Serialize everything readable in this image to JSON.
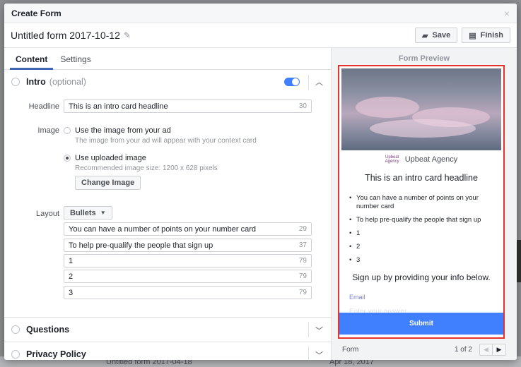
{
  "modal": {
    "title": "Create Form",
    "close": "×"
  },
  "form": {
    "name": "Untitled form 2017-10-12",
    "save_label": "Save",
    "finish_label": "Finish"
  },
  "tabs": [
    {
      "label": "Content",
      "active": true
    },
    {
      "label": "Settings",
      "active": false
    }
  ],
  "intro": {
    "title": "Intro",
    "optional": "(optional)",
    "enabled": true,
    "headline_label": "Headline",
    "headline_value": "This is an intro card headline",
    "headline_count": "30",
    "image_label": "Image",
    "image_option1_title": "Use the image from your ad",
    "image_option1_sub": "The image from your ad will appear with your context card",
    "image_option2_title": "Use uploaded image",
    "image_option2_sub": "Recommended image size: 1200 x 628 pixels",
    "change_image": "Change Image",
    "layout_label": "Layout",
    "layout_value": "Bullets",
    "bullets": [
      {
        "text": "You can have a number of points on your number card",
        "count": "29"
      },
      {
        "text": "To help pre-qualify the people that sign up",
        "count": "37"
      },
      {
        "text": "1",
        "count": "79"
      },
      {
        "text": "2",
        "count": "79"
      },
      {
        "text": "3",
        "count": "79"
      }
    ]
  },
  "sections": {
    "questions": "Questions",
    "privacy": "Privacy Policy"
  },
  "preview": {
    "title": "Form Preview",
    "brand_logo": "Upbeat Agency",
    "brand_name": "Upbeat Agency",
    "headline": "This is an intro card headline",
    "bullets": [
      "You can have a number of points on your number card",
      "To help pre-qualify the people that sign up",
      "1",
      "2",
      "3"
    ],
    "signup_text": "Sign up by providing your info below.",
    "email_label": "Email",
    "email_placeholder": "Enter your answer.",
    "submit_label": "Submit",
    "footer_label": "Form",
    "pager_text": "1 of 2"
  },
  "background": {
    "row_name": "Untitled form 2017-04-18",
    "row_date": "Apr 18, 2017"
  },
  "colors": {
    "accent": "#4080ff",
    "preview_border": "#e5322d"
  }
}
